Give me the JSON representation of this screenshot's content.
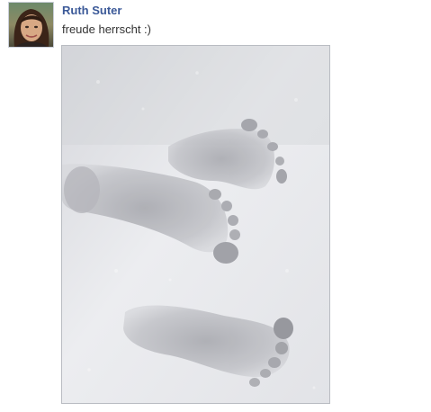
{
  "post": {
    "author": "Ruth Suter",
    "message": "freude herrscht :)"
  },
  "colors": {
    "author_link": "#3b5998",
    "message_text": "#333333",
    "photo_border": "#b9bcc2"
  },
  "icons": {
    "avatar": "profile-photo",
    "photo": "snow-footprints-photo"
  }
}
